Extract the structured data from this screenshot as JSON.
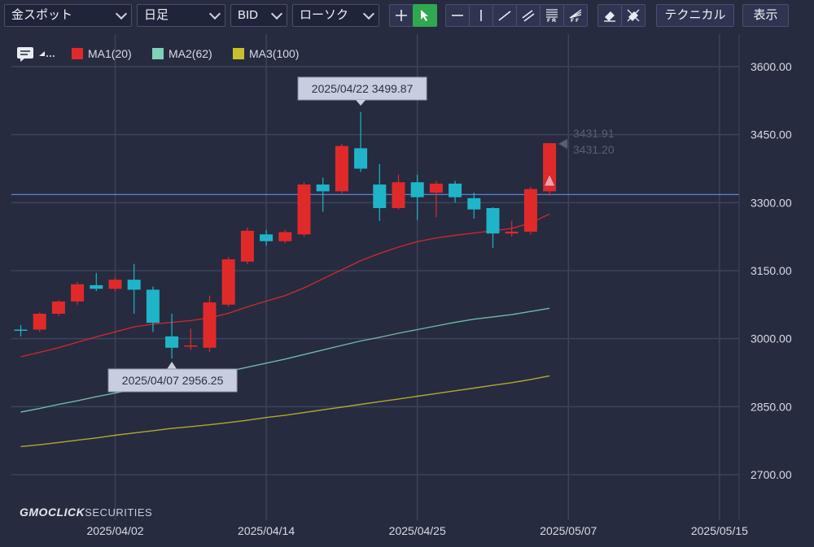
{
  "toolbar": {
    "symbol": "金スポット",
    "timeframe": "日足",
    "price_type": "BID",
    "chart_style": "ローソク",
    "technical_label": "テクニカル",
    "display_label": "表示",
    "accent": "#2fa84f"
  },
  "legend": {
    "items": [
      {
        "label": "MA1(20)",
        "color": "#e02a2a"
      },
      {
        "label": "MA2(62)",
        "color": "#7fd1b9"
      },
      {
        "label": "MA3(100)",
        "color": "#c8c02a"
      }
    ]
  },
  "watermark": {
    "brand": "GMOCLICK",
    "suffix": "SECURITIES"
  },
  "chart_data": {
    "type": "candlestick",
    "ylim": [
      2630,
      3670
    ],
    "y_ticks": [
      "3600.00",
      "3450.00",
      "3300.00",
      "3150.00",
      "3000.00",
      "2850.00",
      "2700.00"
    ],
    "y_tick_values": [
      3600,
      3450,
      3300,
      3150,
      3000,
      2850,
      2700
    ],
    "x_tick_labels": [
      "2025/04/02",
      "2025/04/14",
      "2025/04/25",
      "2025/05/07",
      "2025/05/15"
    ],
    "x_tick_index": [
      5,
      13,
      21,
      29,
      37
    ],
    "up_color": "#e02a2a",
    "down_color": "#1fb5c8",
    "candles": [
      {
        "o": 3020,
        "h": 3030,
        "l": 3005,
        "c": 3020
      },
      {
        "o": 3020,
        "h": 3058,
        "l": 3015,
        "c": 3055
      },
      {
        "o": 3055,
        "h": 3085,
        "l": 3050,
        "c": 3082
      },
      {
        "o": 3082,
        "h": 3125,
        "l": 3075,
        "c": 3120
      },
      {
        "o": 3118,
        "h": 3145,
        "l": 3105,
        "c": 3110
      },
      {
        "o": 3110,
        "h": 3135,
        "l": 3105,
        "c": 3130
      },
      {
        "o": 3130,
        "h": 3165,
        "l": 3055,
        "c": 3108
      },
      {
        "o": 3108,
        "h": 3115,
        "l": 3015,
        "c": 3035
      },
      {
        "o": 3005,
        "h": 3055,
        "l": 2956.25,
        "c": 2980
      },
      {
        "o": 2985,
        "h": 3022,
        "l": 2975,
        "c": 2985
      },
      {
        "o": 2980,
        "h": 3095,
        "l": 2970,
        "c": 3080
      },
      {
        "o": 3075,
        "h": 3180,
        "l": 3070,
        "c": 3175
      },
      {
        "o": 3170,
        "h": 3245,
        "l": 3165,
        "c": 3238
      },
      {
        "o": 3230,
        "h": 3240,
        "l": 3205,
        "c": 3215
      },
      {
        "o": 3215,
        "h": 3240,
        "l": 3210,
        "c": 3235
      },
      {
        "o": 3230,
        "h": 3345,
        "l": 3225,
        "c": 3340
      },
      {
        "o": 3340,
        "h": 3355,
        "l": 3280,
        "c": 3325
      },
      {
        "o": 3325,
        "h": 3430,
        "l": 3320,
        "c": 3425
      },
      {
        "o": 3420,
        "h": 3499.87,
        "l": 3368,
        "c": 3375
      },
      {
        "o": 3340,
        "h": 3385,
        "l": 3260,
        "c": 3288
      },
      {
        "o": 3288,
        "h": 3362,
        "l": 3285,
        "c": 3345
      },
      {
        "o": 3345,
        "h": 3362,
        "l": 3262,
        "c": 3312
      },
      {
        "o": 3322,
        "h": 3348,
        "l": 3268,
        "c": 3342
      },
      {
        "o": 3342,
        "h": 3348,
        "l": 3300,
        "c": 3312
      },
      {
        "o": 3310,
        "h": 3322,
        "l": 3265,
        "c": 3285
      },
      {
        "o": 3288,
        "h": 3290,
        "l": 3200,
        "c": 3232
      },
      {
        "o": 3232,
        "h": 3260,
        "l": 3225,
        "c": 3236
      },
      {
        "o": 3236,
        "h": 3335,
        "l": 3230,
        "c": 3330
      },
      {
        "o": 3325,
        "h": 3432,
        "l": 3315,
        "c": 3431.2
      }
    ],
    "ma_lines": [
      {
        "name": "MA1(20)",
        "color": "#e02a2a",
        "values": [
          2960,
          2970,
          2980,
          2992,
          3004,
          3015,
          3026,
          3032,
          3036,
          3040,
          3046,
          3056,
          3070,
          3083,
          3095,
          3112,
          3132,
          3152,
          3172,
          3188,
          3202,
          3214,
          3222,
          3228,
          3233,
          3238,
          3243,
          3255,
          3275
        ]
      },
      {
        "name": "MA2(62)",
        "color": "#7fd1b9",
        "values": [
          2838,
          2846,
          2855,
          2863,
          2872,
          2880,
          2888,
          2896,
          2903,
          2911,
          2919,
          2928,
          2937,
          2946,
          2955,
          2965,
          2975,
          2985,
          2995,
          3003,
          3012,
          3020,
          3028,
          3036,
          3043,
          3048,
          3053,
          3060,
          3067
        ]
      },
      {
        "name": "MA3(100)",
        "color": "#c8c02a",
        "values": [
          2762,
          2766,
          2771,
          2776,
          2781,
          2787,
          2792,
          2797,
          2802,
          2806,
          2810,
          2815,
          2820,
          2826,
          2831,
          2837,
          2843,
          2849,
          2855,
          2861,
          2867,
          2873,
          2879,
          2885,
          2891,
          2897,
          2903,
          2910,
          2918
        ]
      }
    ],
    "horizontal_line": 3318,
    "current_bid": "3431.91",
    "current_ask": "3431.20",
    "annotations": [
      {
        "label": "2025/04/22 3499.87",
        "index": 18,
        "value": 3499.87,
        "position": "above"
      },
      {
        "label": "2025/04/07 2956.25",
        "index": 8,
        "value": 2956.25,
        "position": "below"
      }
    ]
  }
}
